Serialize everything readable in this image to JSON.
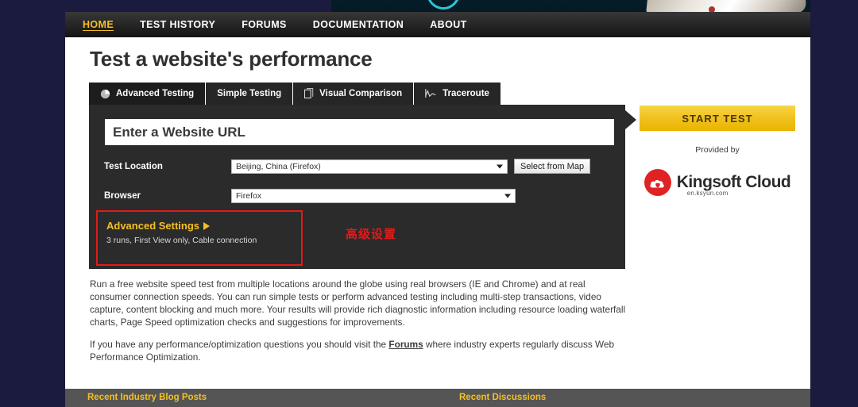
{
  "nav": {
    "items": [
      {
        "label": "HOME",
        "active": true
      },
      {
        "label": "TEST HISTORY",
        "active": false
      },
      {
        "label": "FORUMS",
        "active": false
      },
      {
        "label": "DOCUMENTATION",
        "active": false
      },
      {
        "label": "ABOUT",
        "active": false
      }
    ]
  },
  "page": {
    "title": "Test a website's performance"
  },
  "tabs": [
    {
      "label": "Advanced Testing",
      "icon": "pie-chart-icon",
      "active": true
    },
    {
      "label": "Simple Testing",
      "icon": "",
      "active": false
    },
    {
      "label": "Visual Comparison",
      "icon": "document-pages-icon",
      "active": false
    },
    {
      "label": "Traceroute",
      "icon": "line-chart-icon",
      "active": false
    }
  ],
  "form": {
    "url_placeholder": "Enter a Website URL",
    "url_value": "",
    "test_location_label": "Test Location",
    "test_location_value": "Beijing, China (Firefox)",
    "select_from_map_label": "Select from Map",
    "browser_label": "Browser",
    "browser_value": "Firefox",
    "advanced": {
      "title": "Advanced Settings",
      "summary": "3 runs, First View only, Cable connection"
    }
  },
  "annotation": {
    "text": "高级设置",
    "color": "#e01b1b"
  },
  "sidebar": {
    "start_test_label": "START TEST",
    "provided_by_label": "Provided by",
    "logo_name": "Kingsoft Cloud",
    "logo_sub": "en.ksyun.com"
  },
  "content": {
    "paragraph1_a": "Run a free website speed test from multiple locations around the globe using real browsers (IE and Chrome) and at real consumer connection speeds. You can run simple tests or perform advanced testing including multi-step transactions, video capture, content blocking and much more. Your results will provide rich diagnostic information including resource loading waterfall charts, Page Speed optimization checks and suggestions for improvements.",
    "paragraph2_a": "If you have any performance/optimization questions you should visit the ",
    "paragraph2_link": "Forums",
    "paragraph2_b": " where industry experts regularly discuss Web Performance Optimization."
  },
  "footer": {
    "left_label": "Recent Industry Blog Posts",
    "right_label": "Recent Discussions"
  },
  "colors": {
    "accent_yellow": "#f4c024",
    "page_bg": "#1b1a3f",
    "panel_dark": "#2b2b2b",
    "annotation_red": "#e01b1b"
  }
}
